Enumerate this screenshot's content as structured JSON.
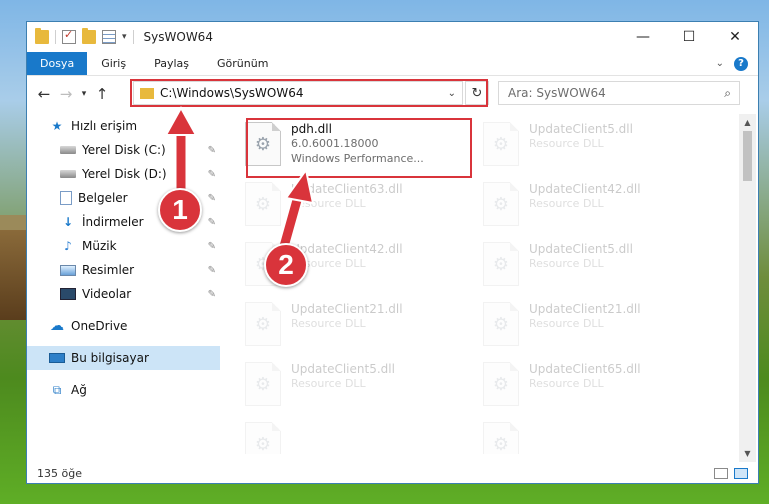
{
  "window": {
    "title": "SysWOW64",
    "controls": [
      "—",
      "☐",
      "✕"
    ]
  },
  "ribbon": {
    "tabs": [
      "Dosya",
      "Giriş",
      "Paylaş",
      "Görünüm"
    ]
  },
  "navigation": {
    "address": "C:\\Windows\\SysWOW64",
    "search_placeholder": "Ara: SysWOW64"
  },
  "sidebar": {
    "quick_access_label": "Hızlı erişim",
    "items": [
      {
        "label": "Yerel Disk (C:)",
        "icon": "drive-icon"
      },
      {
        "label": "Yerel Disk (D:)",
        "icon": "drive-icon"
      },
      {
        "label": "Belgeler",
        "icon": "documents-icon"
      },
      {
        "label": "İndirmeler",
        "icon": "downloads-icon"
      },
      {
        "label": "Müzik",
        "icon": "music-icon"
      },
      {
        "label": "Resimler",
        "icon": "pictures-icon"
      },
      {
        "label": "Videolar",
        "icon": "videos-icon"
      }
    ],
    "onedrive": "OneDrive",
    "this_pc": "Bu bilgisayar",
    "network": "Ağ"
  },
  "files": {
    "highlighted": {
      "name": "pdh.dll",
      "version": "6.0.6001.18000",
      "description": "Windows Performance..."
    },
    "faded": [
      {
        "name": "UpdateClient5.dll",
        "type": "Resource DLL"
      },
      {
        "name": "UpdateClient63.dll",
        "type": "Resource DLL"
      },
      {
        "name": "UpdateClient42.dll",
        "type": "Resource DLL"
      },
      {
        "name": "UpdateClient42.dll",
        "type": "Resource DLL"
      },
      {
        "name": "UpdateClient5.dll",
        "type": "Resource DLL"
      },
      {
        "name": "UpdateClient21.dll",
        "type": "Resource DLL"
      },
      {
        "name": "UpdateClient21.dll",
        "type": "Resource DLL"
      },
      {
        "name": "UpdateClient5.dll",
        "type": "Resource DLL"
      },
      {
        "name": "UpdateClient65.dll",
        "type": "Resource DLL"
      }
    ]
  },
  "status": {
    "item_count": "135 öğe"
  },
  "annotations": {
    "step1": "1",
    "step2": "2",
    "color": "#d9343b"
  }
}
